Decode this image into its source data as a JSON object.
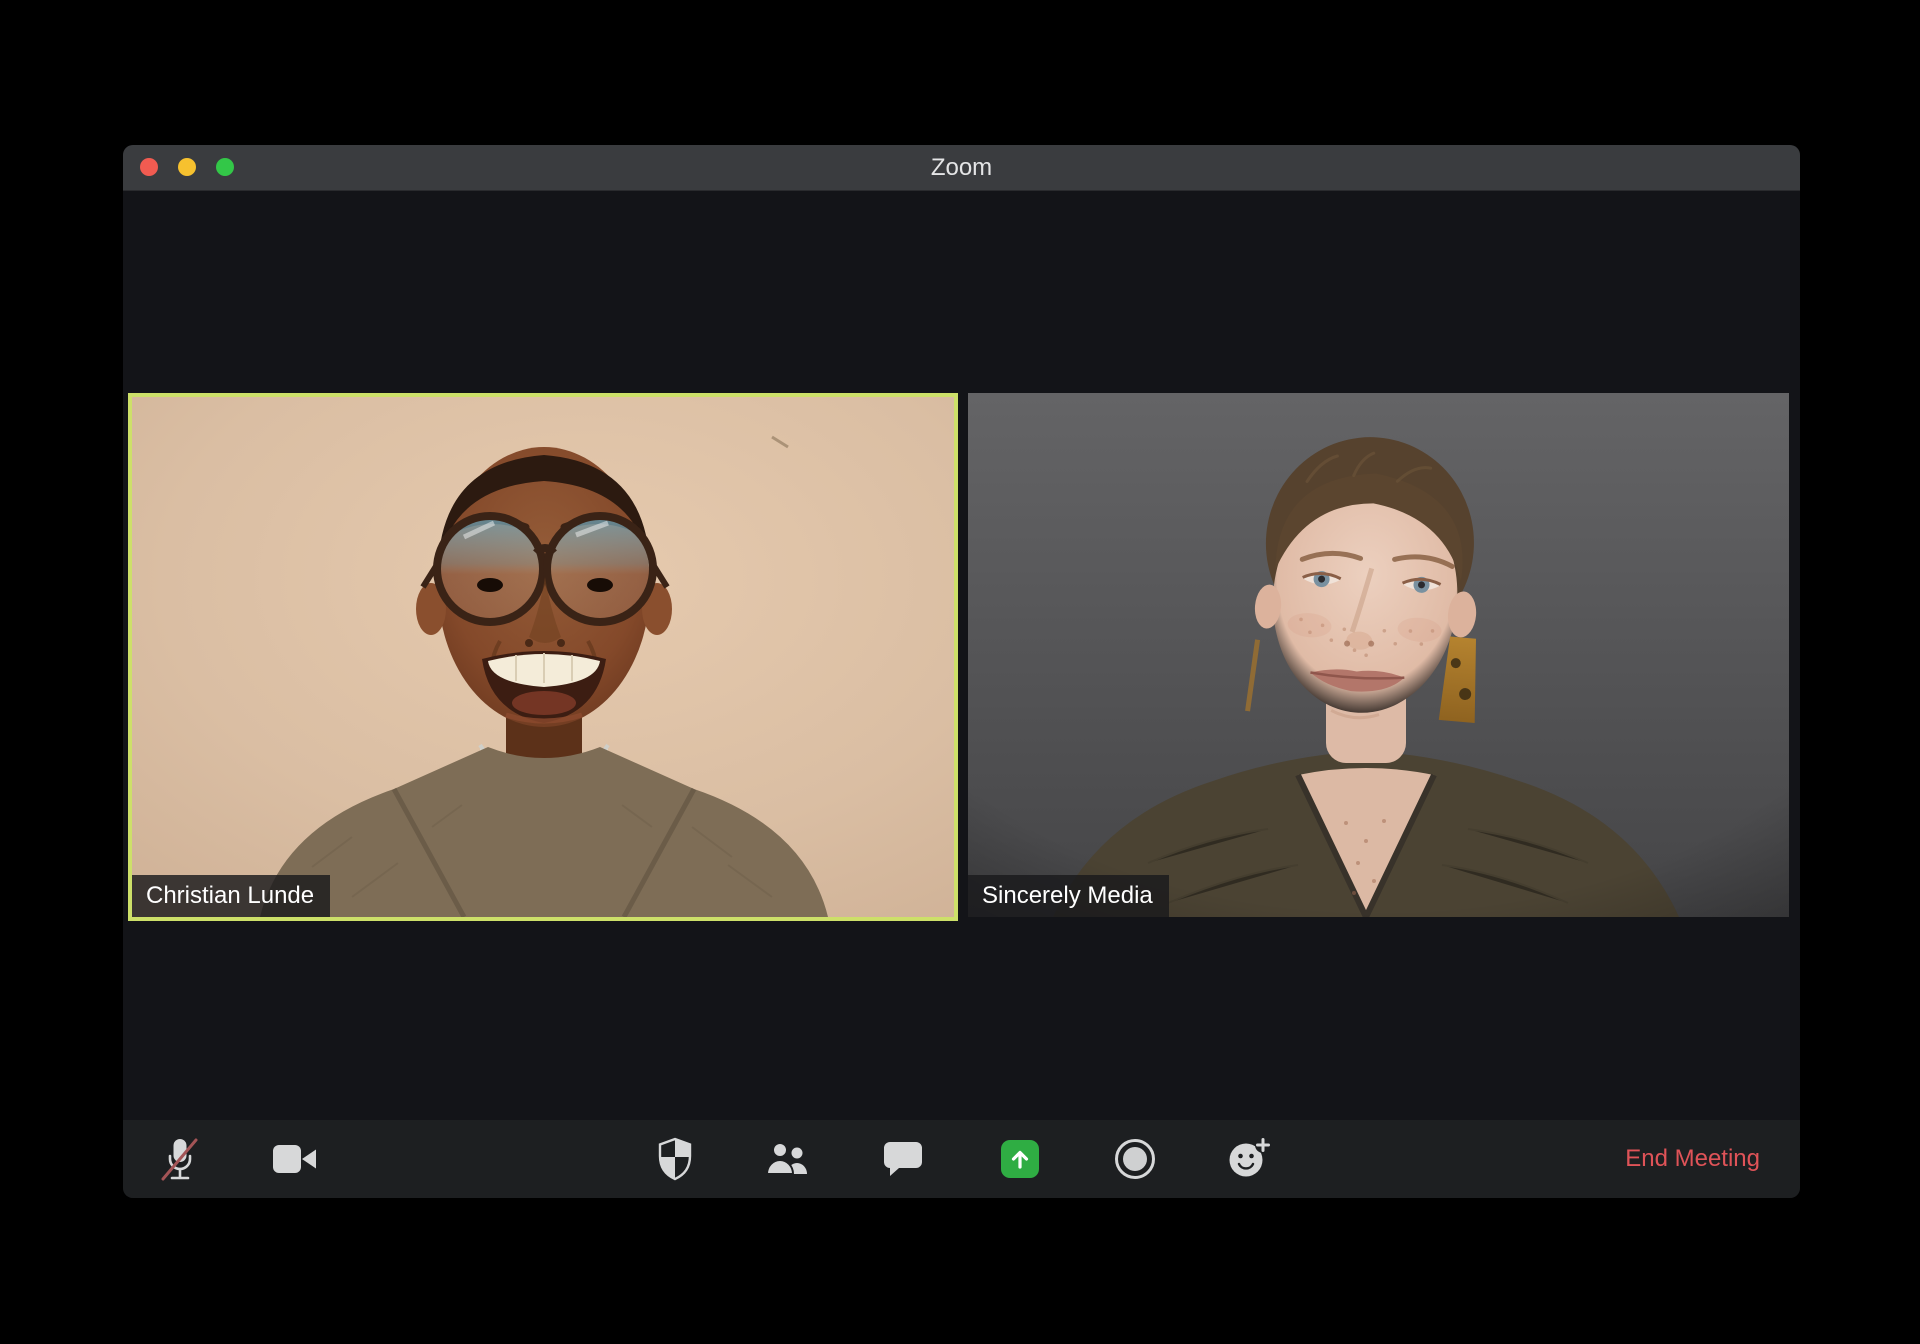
{
  "window": {
    "title": "Zoom",
    "traffic_lights": [
      "close",
      "minimize",
      "fullscreen"
    ]
  },
  "participants": [
    {
      "name": "Christian Lunde",
      "active_speaker": true
    },
    {
      "name": "Sincerely Media",
      "active_speaker": false
    }
  ],
  "toolbar": {
    "buttons": [
      {
        "icon": "microphone-muted-icon",
        "state": "muted"
      },
      {
        "icon": "video-camera-icon",
        "state": "on"
      },
      {
        "icon": "security-shield-icon",
        "state": "default"
      },
      {
        "icon": "participants-icon",
        "state": "default"
      },
      {
        "icon": "chat-icon",
        "state": "default"
      },
      {
        "icon": "share-screen-icon",
        "state": "highlighted"
      },
      {
        "icon": "record-icon",
        "state": "default"
      },
      {
        "icon": "reactions-icon",
        "state": "default"
      }
    ],
    "end_meeting_label": "End Meeting"
  },
  "colors": {
    "active-speaker-border": "#cde069",
    "share-screen-green": "#2fad43",
    "end-meeting-red": "#df5358",
    "traffic-red": "#f15b51",
    "traffic-yellow": "#f6c12f",
    "traffic-green": "#33c748",
    "titlebar-bg": "#3a3c3f",
    "window-bg": "#131418",
    "toolbar-bg": "#1d1f21"
  }
}
